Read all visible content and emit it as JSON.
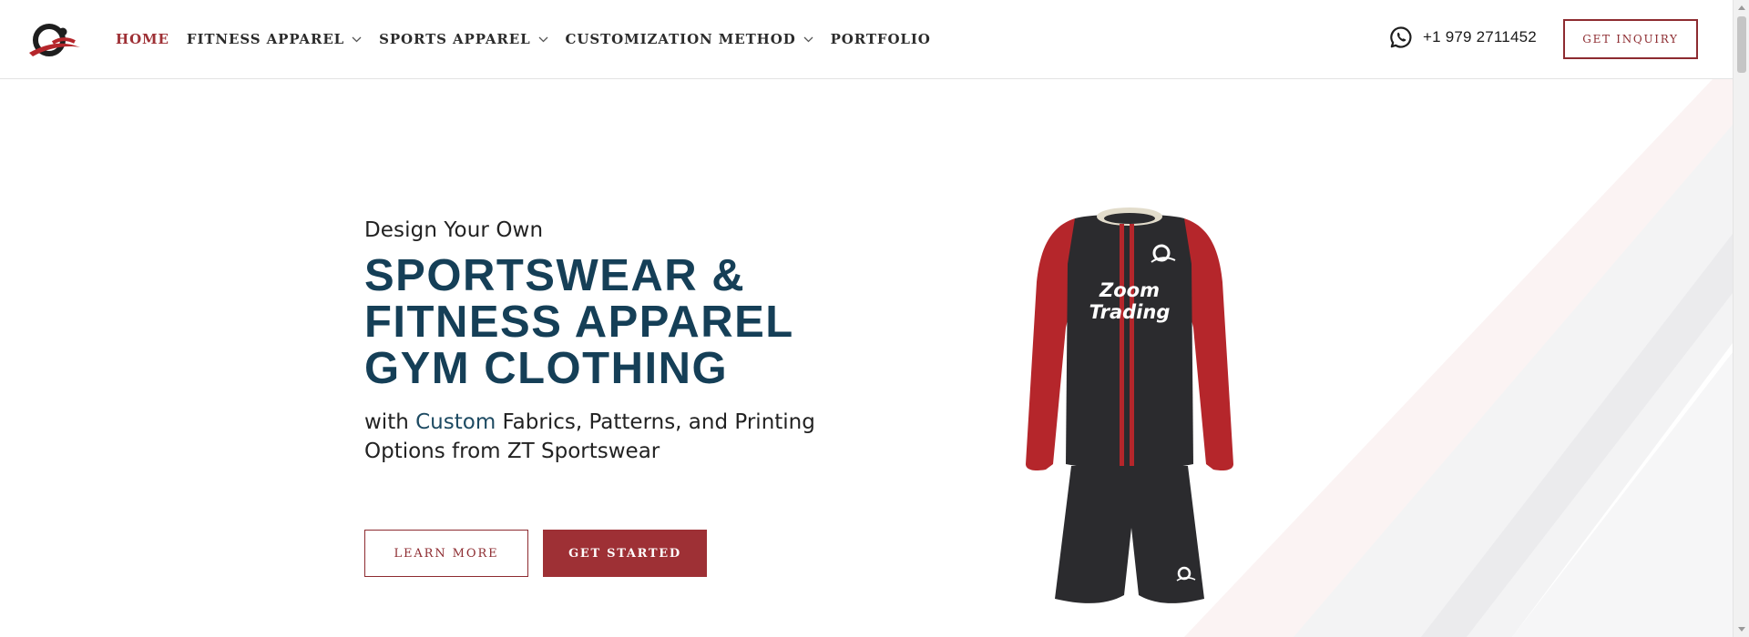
{
  "header": {
    "logo_name": "zoom-trading-logo",
    "nav": [
      {
        "label": "HOME",
        "active": true,
        "has_dropdown": false
      },
      {
        "label": "FITNESS APPAREL",
        "active": false,
        "has_dropdown": true
      },
      {
        "label": "SPORTS APPAREL",
        "active": false,
        "has_dropdown": true
      },
      {
        "label": "CUSTOMIZATION METHOD",
        "active": false,
        "has_dropdown": true
      },
      {
        "label": "PORTFOLIO",
        "active": false,
        "has_dropdown": false
      }
    ],
    "phone": "+1 979 2711452",
    "phone_icon": "whatsapp-icon",
    "inquiry_label": "GET INQUIRY"
  },
  "hero": {
    "pre_title": "Design Your Own",
    "title_lines": [
      "SPORTSWEAR &",
      "FITNESS APPAREL",
      "GYM CLOTHING"
    ],
    "sub_before": "with ",
    "sub_highlight": "Custom",
    "sub_after": " Fabrics, Patterns, and Printing Options from ZT Sportswear",
    "learn_more_label": "LEARN MORE",
    "get_started_label": "GET STARTED",
    "kit_brand_line1": "Zoom",
    "kit_brand_line2": "Trading"
  },
  "colors": {
    "accent": "#9e3035",
    "title_blue": "#153f57",
    "jersey_black": "#2b2b2e",
    "jersey_red": "#b5262b",
    "collar": "#e2dccb"
  }
}
